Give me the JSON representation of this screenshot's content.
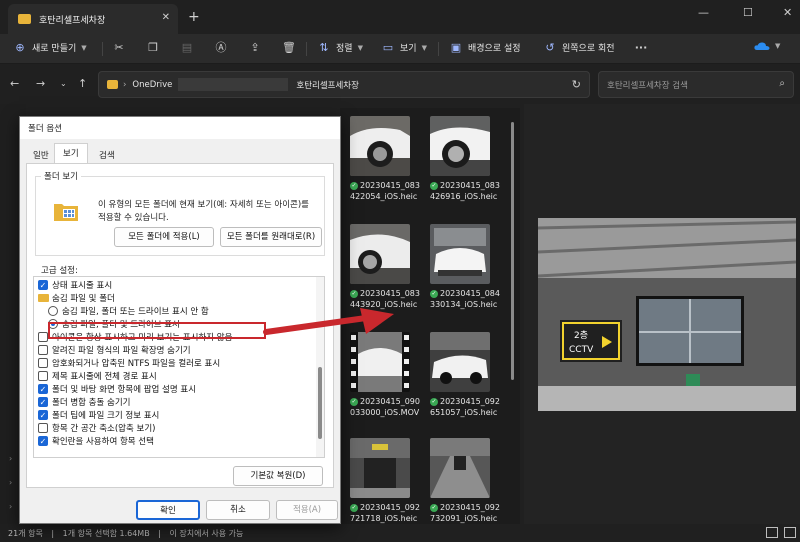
{
  "window": {
    "tab_title": "호탄리셀프세차장",
    "tab_close": "✕",
    "new_tab": "+",
    "minimize": "—",
    "maximize": "☐",
    "close": "✕"
  },
  "toolbar": {
    "new_label": "새로 만들기",
    "sort_label": "정렬",
    "view_label": "보기",
    "set_background_label": "배경으로 설정",
    "rotate_left_label": "왼쪽으로 회전",
    "more_label": "···"
  },
  "address": {
    "crumb_root": "OneDrive",
    "crumb_folder": "호탄리셀프세차장",
    "search_placeholder": "호탄리셀프세차장 검색"
  },
  "files": [
    {
      "name": "20230415_083422054_iOS.heic"
    },
    {
      "name": "20230415_083426916_iOS.heic"
    },
    {
      "name": "20230415_083443920_iOS.heic"
    },
    {
      "name": "20230415_084330134_iOS.heic"
    },
    {
      "name": "20230415_090033000_iOS.MOV"
    },
    {
      "name": "20230415_092651057_iOS.heic"
    },
    {
      "name": "20230415_092721718_iOS.heic"
    },
    {
      "name": "20230415_092732091_iOS.heic"
    }
  ],
  "preview": {
    "sign_line1": "2층",
    "sign_line2": "CCTV"
  },
  "status": {
    "item_count": "21개 항목",
    "selection": "1개 항목 선택함 1.64MB",
    "availability": "이 장치에서 사용 가능"
  },
  "dialog": {
    "title": "폴더 옵션",
    "tabs": [
      "일반",
      "보기",
      "검색"
    ],
    "folder_view_group": "폴더 보기",
    "folder_view_desc": "이 유형의 모든 폴더에 현재 보기(예: 자세히 또는 아이콘)를 적용할 수 있습니다.",
    "apply_to_folders": "모든 폴더에 적용(L)",
    "reset_folders": "모든 폴더를 원래대로(R)",
    "advanced_label": "고급 설정:",
    "options": [
      {
        "label": "상태 표시줄 표시",
        "kind": "checkbox",
        "checked": true
      },
      {
        "label": "숨김 파일 및 폴더",
        "kind": "folder",
        "checked": false
      },
      {
        "label": "숨김 파일, 폴더 또는 드라이브 표시 안 함",
        "kind": "radio",
        "checked": false
      },
      {
        "label": "숨김 파일, 폴더 및 드라이브 표시",
        "kind": "radio",
        "checked": true
      },
      {
        "label": "아이콘은 항상 표시하고 미리 보기는 표시하지 않음",
        "kind": "checkbox",
        "checked": false
      },
      {
        "label": "알려진 파일 형식의 파일 확장명 숨기기",
        "kind": "checkbox",
        "checked": false
      },
      {
        "label": "암호화되거나 압축된 NTFS 파일을 컬러로 표시",
        "kind": "checkbox",
        "checked": false
      },
      {
        "label": "제목 표시줄에 전체 경로 표시",
        "kind": "checkbox",
        "checked": false
      },
      {
        "label": "폴더 및 바탕 화면 항목에 팝업 설명 표시",
        "kind": "checkbox",
        "checked": true
      },
      {
        "label": "폴더 병합 충돌 숨기기",
        "kind": "checkbox",
        "checked": true
      },
      {
        "label": "폴더 팁에 파일 크기 정보 표시",
        "kind": "checkbox",
        "checked": true
      },
      {
        "label": "항목 간 공간 축소(압축 보기)",
        "kind": "checkbox",
        "checked": false
      },
      {
        "label": "확인란을 사용하여 항목 선택",
        "kind": "checkbox",
        "checked": true
      }
    ],
    "restore_defaults": "기본값 복원(D)",
    "ok": "확인",
    "cancel": "취소",
    "apply": "적용(A)"
  },
  "colors": {
    "accent": "#1a66d6",
    "highlight": "#c9282d",
    "sync_ok": "#3aa854",
    "folder": "#e8b43a"
  }
}
